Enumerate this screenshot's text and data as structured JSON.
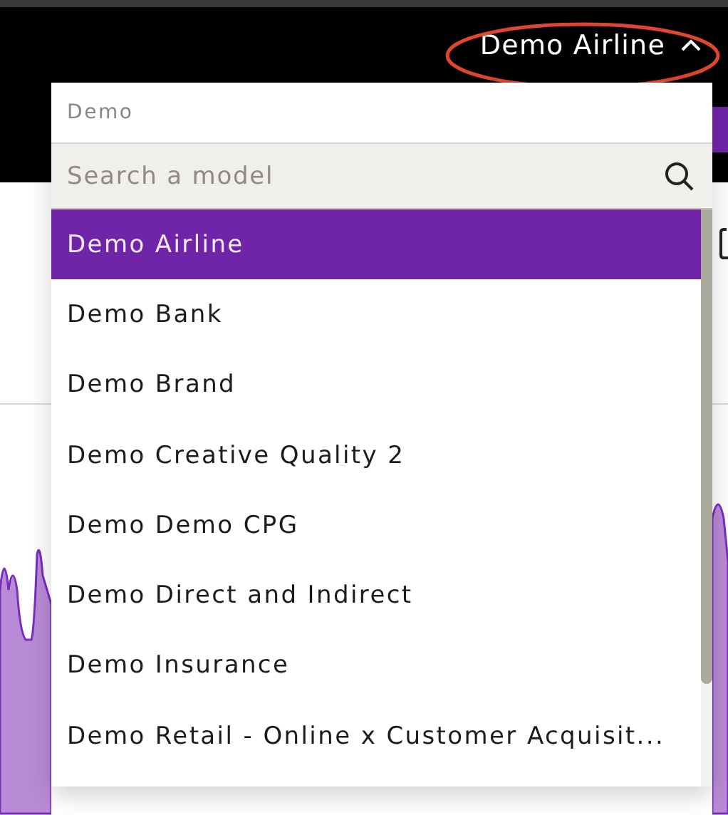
{
  "header": {
    "model_selector": {
      "label": "Demo Airline",
      "expanded": true
    }
  },
  "dropdown": {
    "group_label": "Demo",
    "search": {
      "placeholder": "Search a model"
    },
    "items": [
      {
        "label": "Demo Airline",
        "selected": true
      },
      {
        "label": "Demo Bank",
        "selected": false
      },
      {
        "label": "Demo Brand",
        "selected": false
      },
      {
        "label": "Demo Creative Quality 2",
        "selected": false
      },
      {
        "label": "Demo Demo CPG",
        "selected": false
      },
      {
        "label": "Demo Direct and Indirect",
        "selected": false
      },
      {
        "label": "Demo Insurance",
        "selected": false
      },
      {
        "label": "Demo Retail - Online x Customer Acquisit...",
        "selected": false
      }
    ]
  }
}
